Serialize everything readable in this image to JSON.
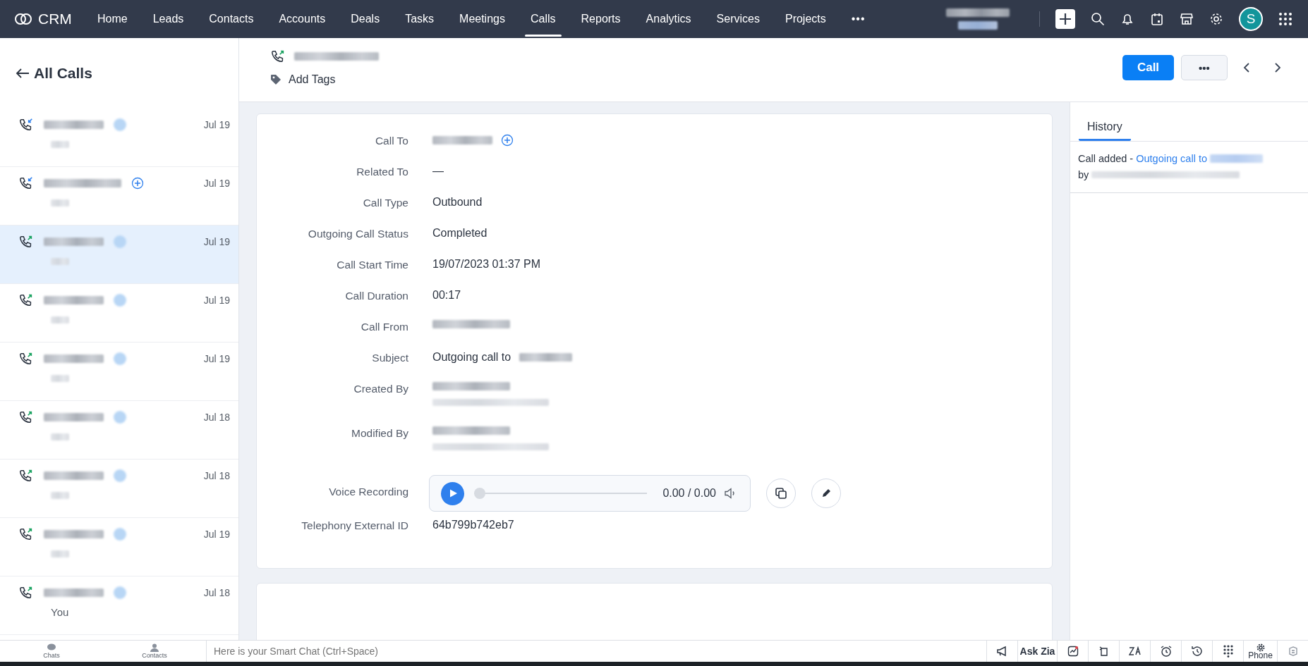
{
  "app": {
    "name": "CRM"
  },
  "nav": {
    "items": [
      {
        "label": "Home",
        "selected": false
      },
      {
        "label": "Leads",
        "selected": false
      },
      {
        "label": "Contacts",
        "selected": false
      },
      {
        "label": "Accounts",
        "selected": false
      },
      {
        "label": "Deals",
        "selected": false
      },
      {
        "label": "Tasks",
        "selected": false
      },
      {
        "label": "Meetings",
        "selected": false
      },
      {
        "label": "Calls",
        "selected": true
      },
      {
        "label": "Reports",
        "selected": false
      },
      {
        "label": "Analytics",
        "selected": false
      },
      {
        "label": "Services",
        "selected": false
      },
      {
        "label": "Projects",
        "selected": false
      }
    ],
    "more": "•••",
    "avatar": "S"
  },
  "sidebar": {
    "back": "All Calls",
    "items": [
      {
        "incoming": true,
        "add_button": false,
        "date": "Jul 19",
        "selected": false
      },
      {
        "incoming": true,
        "add_button": true,
        "date": "Jul 19",
        "selected": false
      },
      {
        "incoming": false,
        "add_button": false,
        "date": "Jul 19",
        "selected": true
      },
      {
        "incoming": false,
        "add_button": false,
        "date": "Jul 19",
        "selected": false
      },
      {
        "incoming": false,
        "add_button": false,
        "date": "Jul 19",
        "selected": false
      },
      {
        "incoming": false,
        "add_button": false,
        "date": "Jul 18",
        "selected": false
      },
      {
        "incoming": false,
        "add_button": false,
        "date": "Jul 18",
        "selected": false
      },
      {
        "incoming": false,
        "add_button": false,
        "date": "Jul 19",
        "selected": false
      },
      {
        "incoming": false,
        "add_button": false,
        "date": "Jul 18",
        "selected": false,
        "subtitle": "You"
      }
    ]
  },
  "record": {
    "incoming": false,
    "add_tags": "Add Tags",
    "call_button": "Call",
    "more_button": "•••"
  },
  "fields": [
    {
      "label": "Call To",
      "kind": "redacted_add"
    },
    {
      "label": "Related To",
      "kind": "text",
      "value": "—"
    },
    {
      "label": "Call Type",
      "kind": "text",
      "value": "Outbound"
    },
    {
      "label": "Outgoing Call Status",
      "kind": "text",
      "value": "Completed"
    },
    {
      "label": "Call Start Time",
      "kind": "text",
      "value": "19/07/2023 01:37 PM"
    },
    {
      "label": "Call Duration",
      "kind": "text",
      "value": "00:17"
    },
    {
      "label": "Call From",
      "kind": "redacted"
    },
    {
      "label": "Subject",
      "kind": "text_redacted",
      "value": "Outgoing call to"
    },
    {
      "label": "Created By",
      "kind": "redacted_two"
    },
    {
      "label": "Modified By",
      "kind": "redacted_two"
    },
    {
      "label": "Voice Recording",
      "kind": "player",
      "time": "0.00 / 0.00",
      "level": 0
    },
    {
      "label": "Telephony External ID",
      "kind": "text",
      "value": "64b799b742eb7"
    }
  ],
  "history": {
    "tabs": [
      {
        "label": "History",
        "selected": true
      }
    ],
    "entries": [
      {
        "action": "Call added",
        "separator": "-",
        "link": "Outgoing call to",
        "by": "by"
      }
    ]
  },
  "footer": {
    "chats": "Chats",
    "contacts": "Contacts",
    "placeholder": "Here is your Smart Chat (Ctrl+Space)",
    "ask_zia": "Ask Zia",
    "phone": "Phone"
  }
}
